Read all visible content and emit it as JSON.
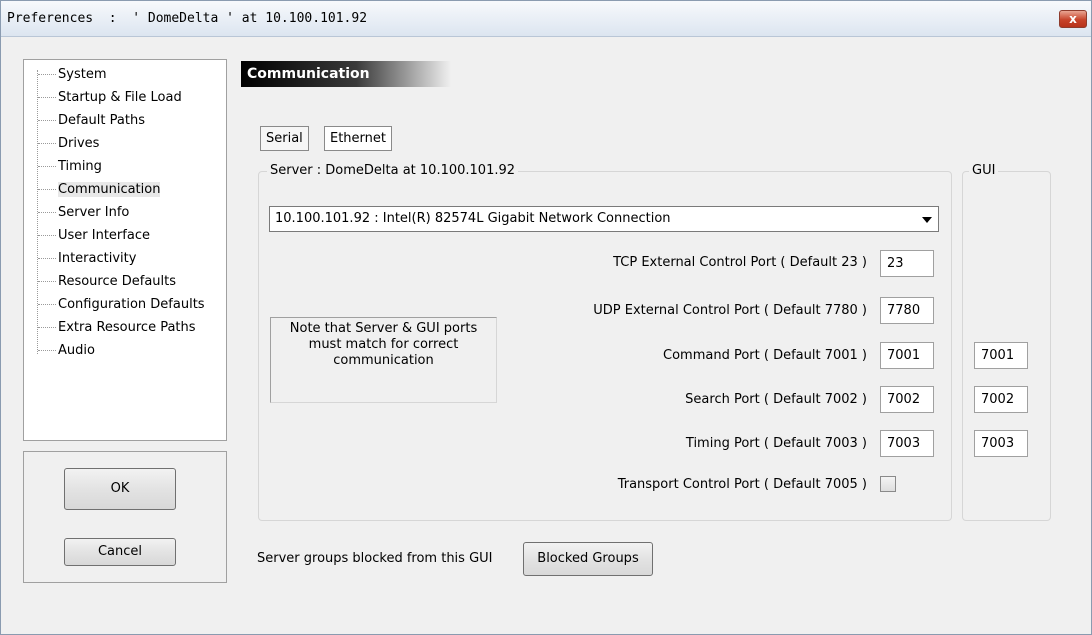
{
  "window": {
    "title": "Preferences  :  ' DomeDelta ' at 10.100.101.92",
    "close_symbol": "x"
  },
  "sidebar": {
    "items": [
      {
        "label": "System",
        "selected": false
      },
      {
        "label": "Startup & File Load",
        "selected": false
      },
      {
        "label": "Default Paths",
        "selected": false
      },
      {
        "label": "Drives",
        "selected": false
      },
      {
        "label": "Timing",
        "selected": false
      },
      {
        "label": "Communication",
        "selected": true
      },
      {
        "label": "Server Info",
        "selected": false
      },
      {
        "label": "User Interface",
        "selected": false
      },
      {
        "label": "Interactivity",
        "selected": false
      },
      {
        "label": "Resource Defaults",
        "selected": false
      },
      {
        "label": "Configuration Defaults",
        "selected": false
      },
      {
        "label": "Extra Resource Paths",
        "selected": false
      },
      {
        "label": "Audio",
        "selected": false
      }
    ],
    "ok_label": "OK",
    "cancel_label": "Cancel"
  },
  "main": {
    "section_title": "Communication",
    "tabs": [
      {
        "label": "Serial",
        "active": false
      },
      {
        "label": "Ethernet",
        "active": true
      }
    ],
    "server_group_title": "Server : DomeDelta  at  10.100.101.92",
    "gui_group_title": "GUI",
    "network_adapter": "10.100.101.92 : Intel(R) 82574L Gigabit Network Connection",
    "note": "Note that Server & GUI ports must match for correct communication",
    "ports": {
      "tcp": {
        "label": "TCP External Control Port ( Default 23 )",
        "server": "23"
      },
      "udp": {
        "label": "UDP External Control Port ( Default 7780 )",
        "server": "7780"
      },
      "command": {
        "label": "Command Port ( Default 7001 )",
        "server": "7001",
        "gui": "7001"
      },
      "search": {
        "label": "Search Port ( Default 7002 )",
        "server": "7002",
        "gui": "7002"
      },
      "timing": {
        "label": "Timing Port ( Default 7003 )",
        "server": "7003",
        "gui": "7003"
      },
      "transport": {
        "label": "Transport Control Port ( Default 7005 )",
        "checked": false
      }
    },
    "blocked_groups_label": "Server groups blocked from this GUI",
    "blocked_groups_button": "Blocked Groups"
  },
  "colors": {
    "window_bg": "#f0f0f0",
    "close_button": "#c7432a",
    "header_bg": "#000000"
  }
}
